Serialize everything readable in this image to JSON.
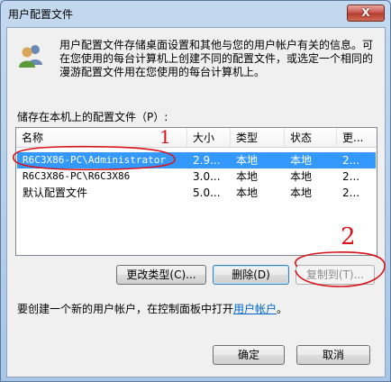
{
  "window": {
    "title": "用户配置文件",
    "close_label": "X"
  },
  "info": {
    "text": "用户配置文件存储桌面设置和其他与您的用户帐户有关的信息。可在您使用的每台计算机上创建不同的配置文件，或选定一个相同的漫游配置文件用在您使用的每台计算机上。"
  },
  "profiles": {
    "label": "储存在本机上的配置文件（P）:",
    "columns": [
      "名称",
      "大小",
      "类型",
      "状态",
      "更..."
    ],
    "rows": [
      {
        "name": "R6C3X86-PC\\Administrator",
        "size": "2.9...",
        "type": "本地",
        "status": "本地",
        "modified": "2..."
      },
      {
        "name": "R6C3X86-PC\\R6C3X86",
        "size": "3.0...",
        "type": "本地",
        "status": "本地",
        "modified": "2..."
      },
      {
        "name": "默认配置文件",
        "size": "5.0...",
        "type": "本地",
        "status": "本地",
        "modified": "2..."
      }
    ]
  },
  "buttons": {
    "change_type": "更改类型(C)...",
    "delete": "删除(D)",
    "copy_to": "复制到(T)...",
    "ok": "确定",
    "cancel": "取消"
  },
  "hint": {
    "prefix": "要创建一个新的用户帐户，在控制面板中打开",
    "link": "用户帐户",
    "suffix": "。"
  },
  "annotations": {
    "mark1": "1",
    "mark2": "2",
    "color": "#d8131b"
  }
}
